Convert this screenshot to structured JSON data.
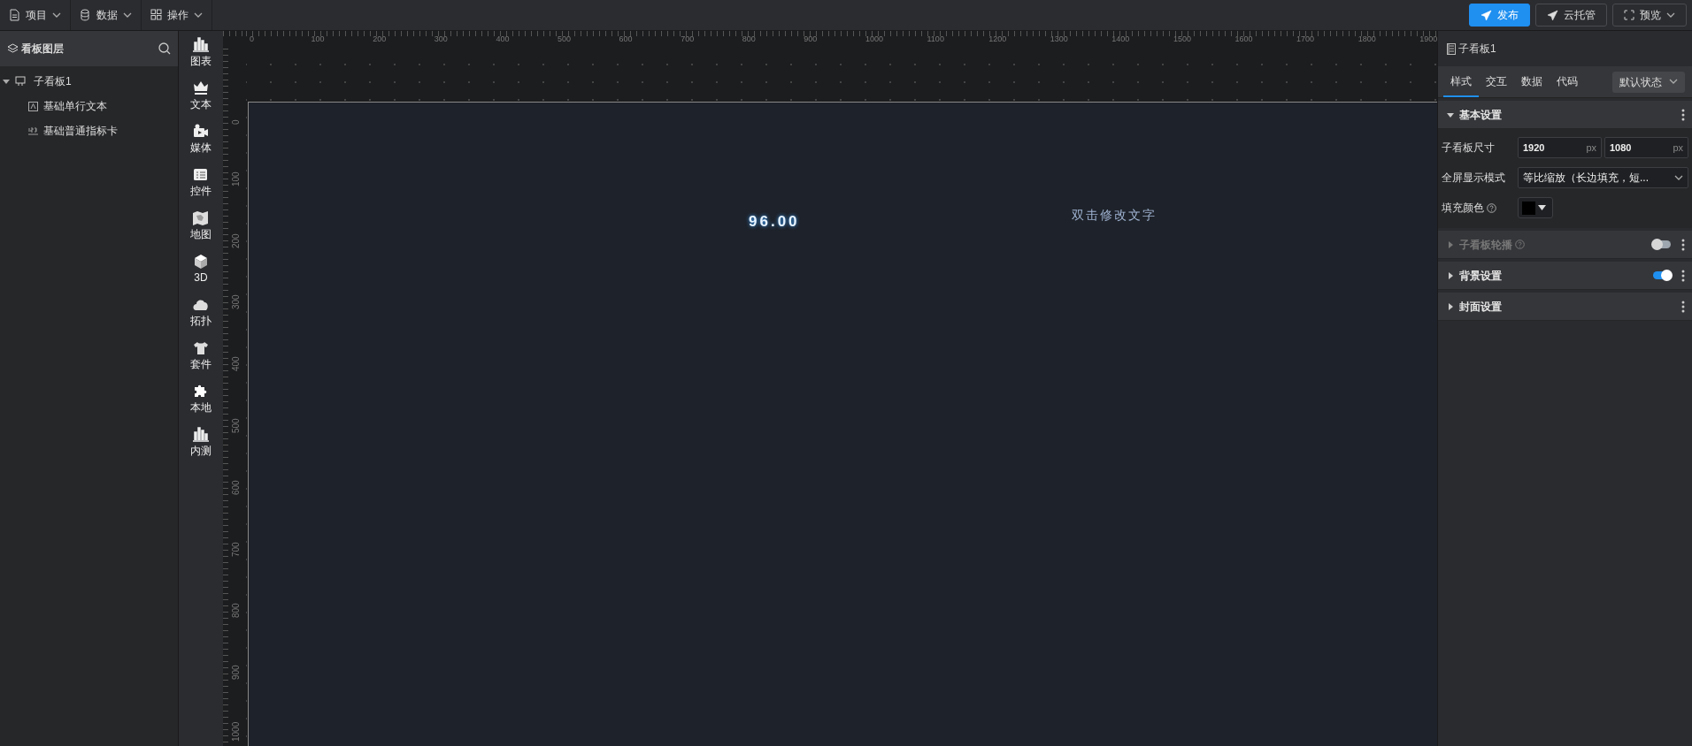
{
  "menu": [
    {
      "label": "项目"
    },
    {
      "label": "数据"
    },
    {
      "label": "操作"
    }
  ],
  "actions": [
    {
      "label": "发布",
      "kind": "primary"
    },
    {
      "label": "云托管",
      "kind": "outline"
    },
    {
      "label": "预览",
      "kind": "dropdown"
    }
  ],
  "layers": {
    "title": "看板图层",
    "tree": [
      {
        "label": "子看板1",
        "expanded": true,
        "children": [
          {
            "label": "基础单行文本"
          },
          {
            "label": "基础普通指标卡"
          }
        ]
      }
    ]
  },
  "components": [
    {
      "label": "图表"
    },
    {
      "label": "文本"
    },
    {
      "label": "媒体"
    },
    {
      "label": "控件"
    },
    {
      "label": "地图"
    },
    {
      "label": "3D"
    },
    {
      "label": "拓扑"
    },
    {
      "label": "套件"
    },
    {
      "label": "本地"
    },
    {
      "label": "内测"
    }
  ],
  "ruler": {
    "x_labels": [
      "0",
      "100",
      "200",
      "300",
      "400",
      "500",
      "600",
      "700",
      "800",
      "900",
      "1000",
      "1100",
      "1200",
      "1300",
      "1400",
      "1500",
      "1600",
      "1700",
      "1800",
      "1900"
    ],
    "y_labels": [
      "0",
      "100",
      "200",
      "300",
      "400",
      "500",
      "600",
      "700",
      "800",
      "900",
      "1000"
    ]
  },
  "canvas": {
    "items": [
      {
        "kind": "metric",
        "text": "96.00"
      },
      {
        "kind": "text",
        "text": "双击修改文字"
      }
    ]
  },
  "inspector": {
    "title": "子看板1",
    "tabs": [
      {
        "label": "样式",
        "selected": true
      },
      {
        "label": "交互",
        "selected": false
      },
      {
        "label": "数据",
        "selected": false
      },
      {
        "label": "代码",
        "selected": false
      }
    ],
    "state_select": "默认状态",
    "sections": [
      {
        "title": "基本设置",
        "expanded": true,
        "disabled": false,
        "help": false,
        "fields": [
          {
            "kind": "size",
            "label": "子看板尺寸",
            "help": false,
            "values": [
              {
                "value": "1920",
                "unit": "px"
              },
              {
                "value": "1080",
                "unit": "px"
              }
            ]
          },
          {
            "kind": "select",
            "label": "全屏显示模式",
            "help": false,
            "value": "等比缩放（长边填充，短..."
          },
          {
            "kind": "color",
            "label": "填充颜色",
            "help": true,
            "color": "#000000"
          }
        ]
      },
      {
        "title": "子看板轮播",
        "expanded": false,
        "disabled": true,
        "help": true,
        "toggle": {
          "on": false
        }
      },
      {
        "title": "背景设置",
        "expanded": false,
        "disabled": false,
        "help": false,
        "toggle": {
          "on": true
        }
      },
      {
        "title": "封面设置",
        "expanded": false,
        "disabled": false,
        "help": false
      }
    ]
  }
}
